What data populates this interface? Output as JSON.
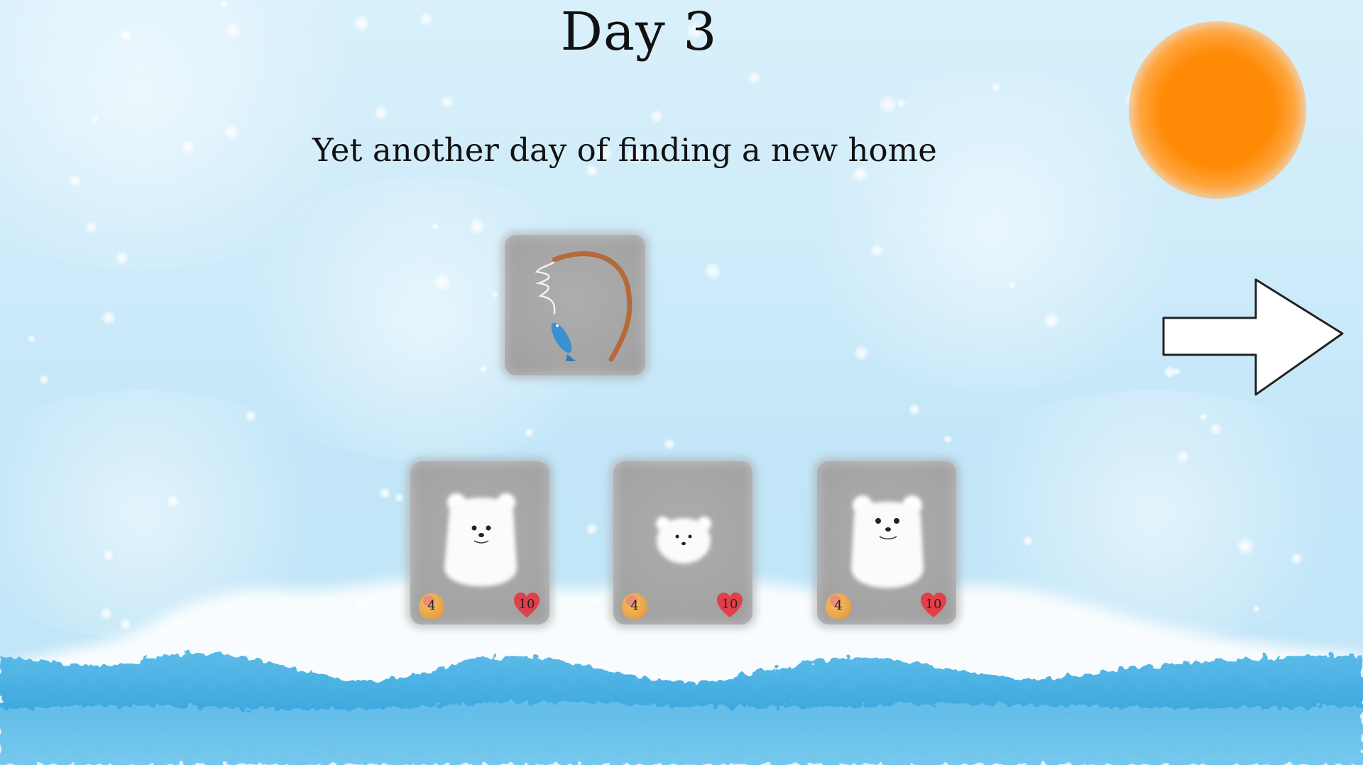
{
  "screen": {
    "title": "Day 3",
    "subtitle": "Yet another day of finding a new home"
  },
  "colors": {
    "sky": "#cdebfa",
    "sun": "#ff8a05",
    "sea": "#3fa9e0",
    "card": "#a8a8a8",
    "attack_badge": "#e7a34a",
    "health_badge": "#e0404a",
    "text": "#111111"
  },
  "item_card": {
    "icon": "fishing-rod-with-fish-icon"
  },
  "bear_cards": [
    {
      "icon": "polar-bear-icon",
      "attack": "4",
      "health": "10"
    },
    {
      "icon": "polar-bear-cub-face-icon",
      "attack": "4",
      "health": "10"
    },
    {
      "icon": "polar-bear-icon",
      "attack": "4",
      "health": "10"
    }
  ],
  "controls": {
    "next_icon": "right-arrow-icon"
  }
}
